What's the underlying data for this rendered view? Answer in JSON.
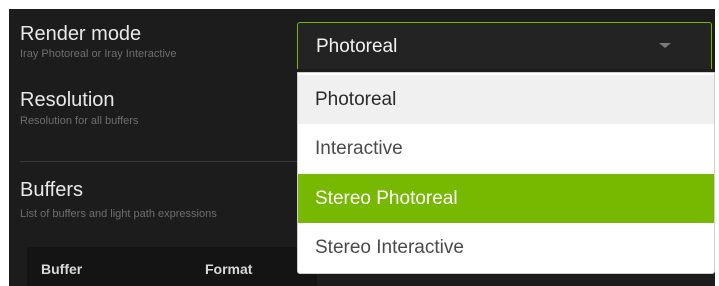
{
  "settings": {
    "render_mode": {
      "label": "Render mode",
      "description": "Iray Photoreal or Iray Interactive"
    },
    "resolution": {
      "label": "Resolution",
      "description": "Resolution for all buffers"
    },
    "buffers": {
      "label": "Buffers",
      "description": "List of buffers and light path expressions",
      "columns": [
        "Buffer",
        "Format"
      ]
    }
  },
  "select": {
    "value": "Photoreal",
    "caret_icon": "chevron-down-icon",
    "options": [
      "Photoreal",
      "Interactive",
      "Stereo Photoreal",
      "Stereo Interactive"
    ],
    "highlighted": "Stereo Photoreal"
  },
  "colors": {
    "accent": "#76b900",
    "panel_background": "#1c1c1c",
    "dropdown_background": "#ffffff"
  }
}
